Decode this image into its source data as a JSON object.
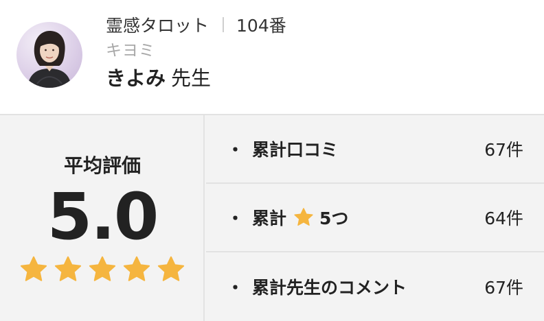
{
  "header": {
    "category": "霊感タロット",
    "number": "104番",
    "kana": "キヨミ",
    "name": "きよみ",
    "honorific": "先生",
    "avatar_icon": "advisor-portrait"
  },
  "rating": {
    "label": "平均評価",
    "score": "5.0",
    "stars_filled": 5,
    "stars_total": 5,
    "star_color": "#f5b53f"
  },
  "stats": [
    {
      "prefix": "・",
      "label": "累計口コミ",
      "star": false,
      "suffix": "",
      "count": "67件"
    },
    {
      "prefix": "・",
      "label": "累計",
      "star": true,
      "suffix": "5つ",
      "count": "64件"
    },
    {
      "prefix": "・",
      "label": "累計先生のコメント",
      "star": false,
      "suffix": "",
      "count": "67件"
    }
  ],
  "colors": {
    "panel_bg": "#f3f3f3",
    "divider": "#e2e2e2",
    "kana": "#a8a8a8",
    "text": "#222222"
  }
}
